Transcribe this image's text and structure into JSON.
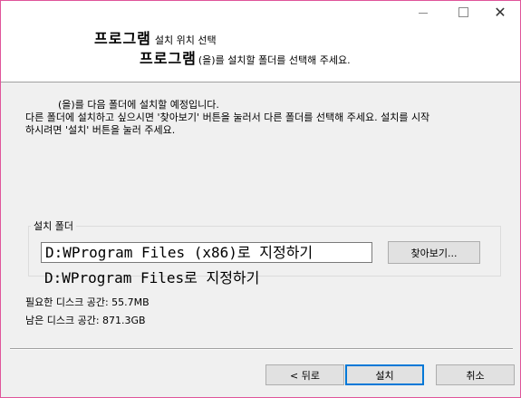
{
  "header": {
    "program_name": "프로그램",
    "title": "설치 위치 선택",
    "subtitle": "(을)를 설치할 폴더를 선택해 주세요."
  },
  "window_controls": {
    "minimize": "minimize-icon",
    "maximize": "maximize-icon",
    "close": "close-icon"
  },
  "intro": {
    "line1": "(을)를 다음 폴더에 설치할 예정입니다.",
    "line2": "다른 폴더에 설치하고 싶으시면 '찾아보기' 버튼을 눌러서 다른 폴더를 선택해 주세요. 설치를 시작",
    "line3": "하시려면 '설치' 버튼을 눌러 주세요."
  },
  "install_folder": {
    "label": "설치 폴더",
    "value": "D:WProgram Files (x86)로 지정하기",
    "browse_label": "찾아보기...",
    "overlay_text": "D:WProgram Files로 지정하기"
  },
  "space": {
    "required": "필요한 디스크 공간: 55.7MB",
    "remaining": "남은 디스크 공간: 871.3GB"
  },
  "buttons": {
    "back": "< 뒤로",
    "install": "설치",
    "cancel": "취소"
  }
}
